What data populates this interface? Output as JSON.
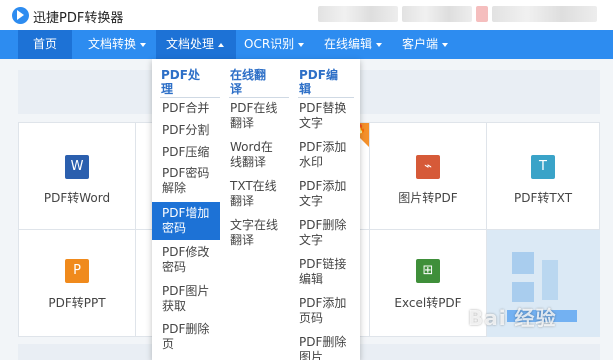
{
  "app": {
    "title": "迅捷PDF转换器"
  },
  "nav": {
    "items": [
      {
        "label": "首页"
      },
      {
        "label": "文档转换"
      },
      {
        "label": "文档处理"
      },
      {
        "label": "OCR识别"
      },
      {
        "label": "在线编辑"
      },
      {
        "label": "客户端"
      }
    ]
  },
  "dropdown": {
    "columns": [
      {
        "header_lines": [
          "PDF处",
          "理"
        ],
        "items": [
          [
            "PDF合并"
          ],
          [
            "PDF分割"
          ],
          [
            "PDF压缩"
          ],
          [
            "PDF密码",
            "解除"
          ],
          [
            "PDF增加",
            "密码"
          ],
          [
            "PDF修改",
            "密码"
          ],
          [
            "PDF图片",
            "获取"
          ],
          [
            "PDF删除",
            "页"
          ]
        ],
        "selected_index": 4
      },
      {
        "header_lines": [
          "在线翻",
          "译"
        ],
        "items": [
          [
            "PDF在线",
            "翻译"
          ],
          [
            "Word在",
            "线翻译"
          ],
          [
            "TXT在线",
            "翻译"
          ],
          [
            "文字在线",
            "翻译"
          ]
        ]
      },
      {
        "header_lines": [
          "PDF编",
          "辑"
        ],
        "items": [
          [
            "PDF替换",
            "文字"
          ],
          [
            "PDF添加",
            "水印"
          ],
          [
            "PDF添加",
            "文字"
          ],
          [
            "PDF删除",
            "文字"
          ],
          [
            "PDF链接",
            "编辑"
          ],
          [
            "PDF添加",
            "页码"
          ],
          [
            "PDF删除",
            "图片"
          ]
        ]
      }
    ]
  },
  "tools": [
    {
      "label": "PDF转Word",
      "icon_text": "W",
      "icon_color": "#2b5fae"
    },
    {
      "label": "图片转PDF",
      "icon_text": "⌁",
      "icon_color": "#d65a38"
    },
    {
      "label": "PDF转TXT",
      "icon_text": "T",
      "icon_color": "#3aa3c8"
    },
    {
      "label": "PDF转PPT",
      "icon_text": "P",
      "icon_color": "#f08a1c"
    },
    {
      "label": "Excel转PDF",
      "icon_text": "⊞",
      "icon_color": "#3f8f3a"
    }
  ],
  "watermark": {
    "text": "Bai 经验"
  },
  "colors": {
    "nav": "#2d8cf0",
    "nav_active": "#1d72d6",
    "menu_header": "#2d6fc7",
    "hot_badge": "#f5912b"
  }
}
